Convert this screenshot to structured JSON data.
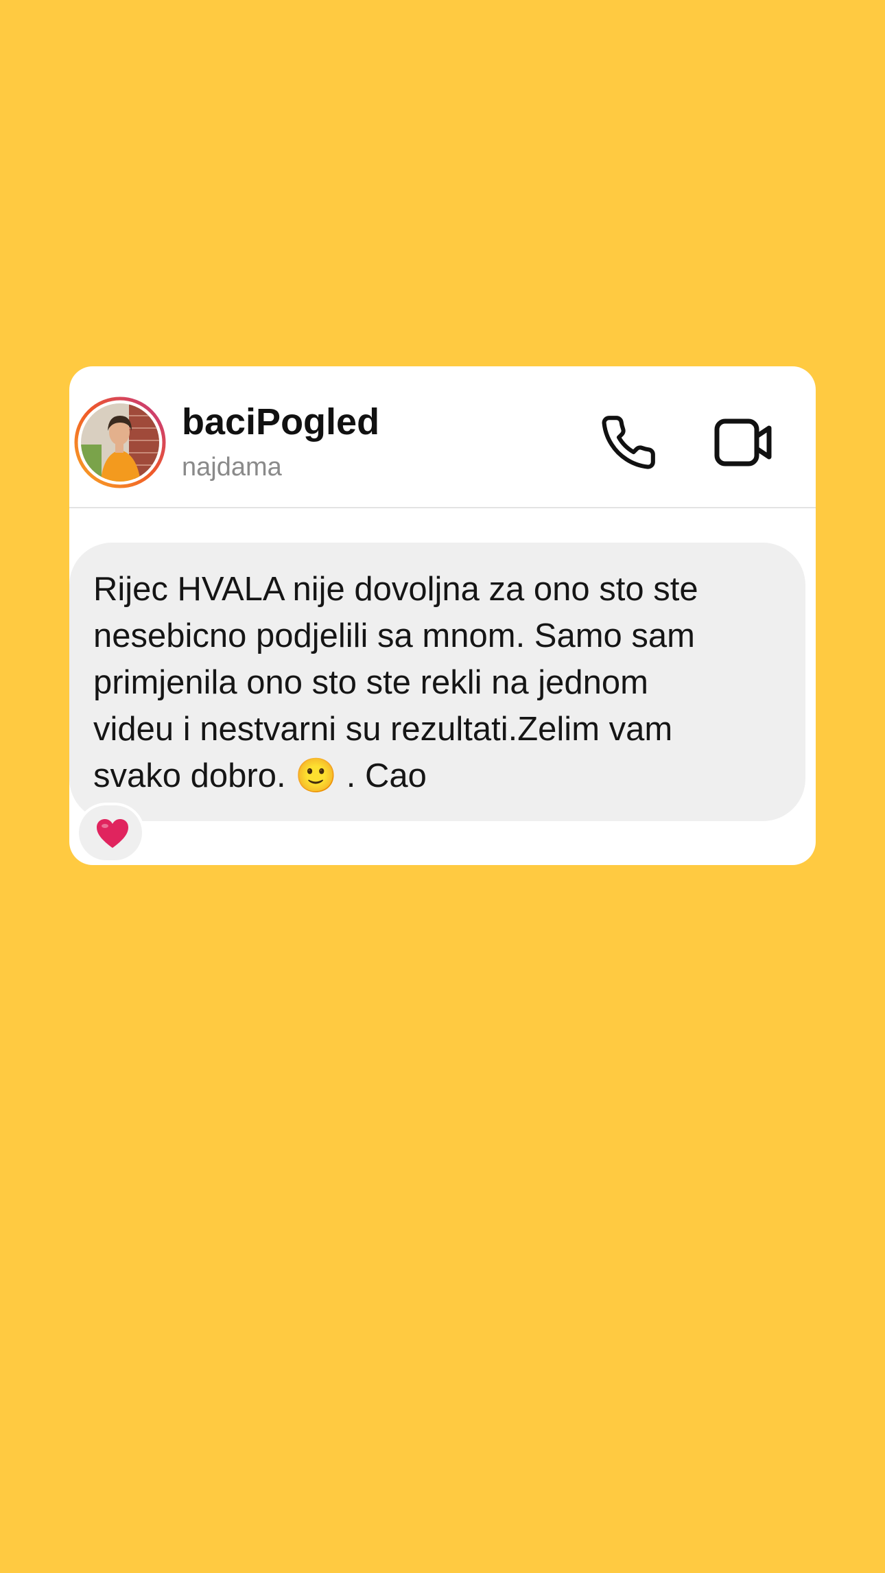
{
  "header": {
    "username": "baciPogled",
    "handle": "najdama"
  },
  "message": {
    "text": "Rijec HVALA nije dovoljna za ono sto ste\nnesebicno podjelili sa mnom. Samo sam\nprimjenila ono sto ste rekli na jednom\nvideu i nestvarni su rezultati.Zelim vam\nsvako dobro. 🙂 . Cao",
    "reaction": "❤️"
  },
  "colors": {
    "background": "#FFCA41",
    "card": "#ffffff",
    "bubble": "#efefef",
    "avatar_ring_start": "#F9A825",
    "avatar_ring_end": "#C13584",
    "heart": "#E0245E"
  },
  "icons": {
    "phone": "phone-icon",
    "video": "video-camera-icon",
    "reaction": "heart-icon"
  }
}
